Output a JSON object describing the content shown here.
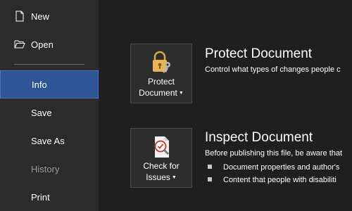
{
  "nav": {
    "new_label": "New",
    "open_label": "Open",
    "info_label": "Info",
    "save_label": "Save",
    "save_as_label": "Save As",
    "history_label": "History",
    "print_label": "Print"
  },
  "protect": {
    "button_line1": "Protect",
    "button_line2": "Document",
    "title": "Protect Document",
    "description": "Control what types of changes people c"
  },
  "inspect": {
    "button_line1": "Check for",
    "button_line2": "Issues",
    "title": "Inspect Document",
    "description": "Before publishing this file, be aware that",
    "bullets": [
      "Document properties and author's",
      "Content that people with disabiliti"
    ]
  },
  "colors": {
    "selected_nav": "#2f5597",
    "sidebar_bg": "#2b2b2b",
    "main_bg": "#1f1f1f"
  }
}
